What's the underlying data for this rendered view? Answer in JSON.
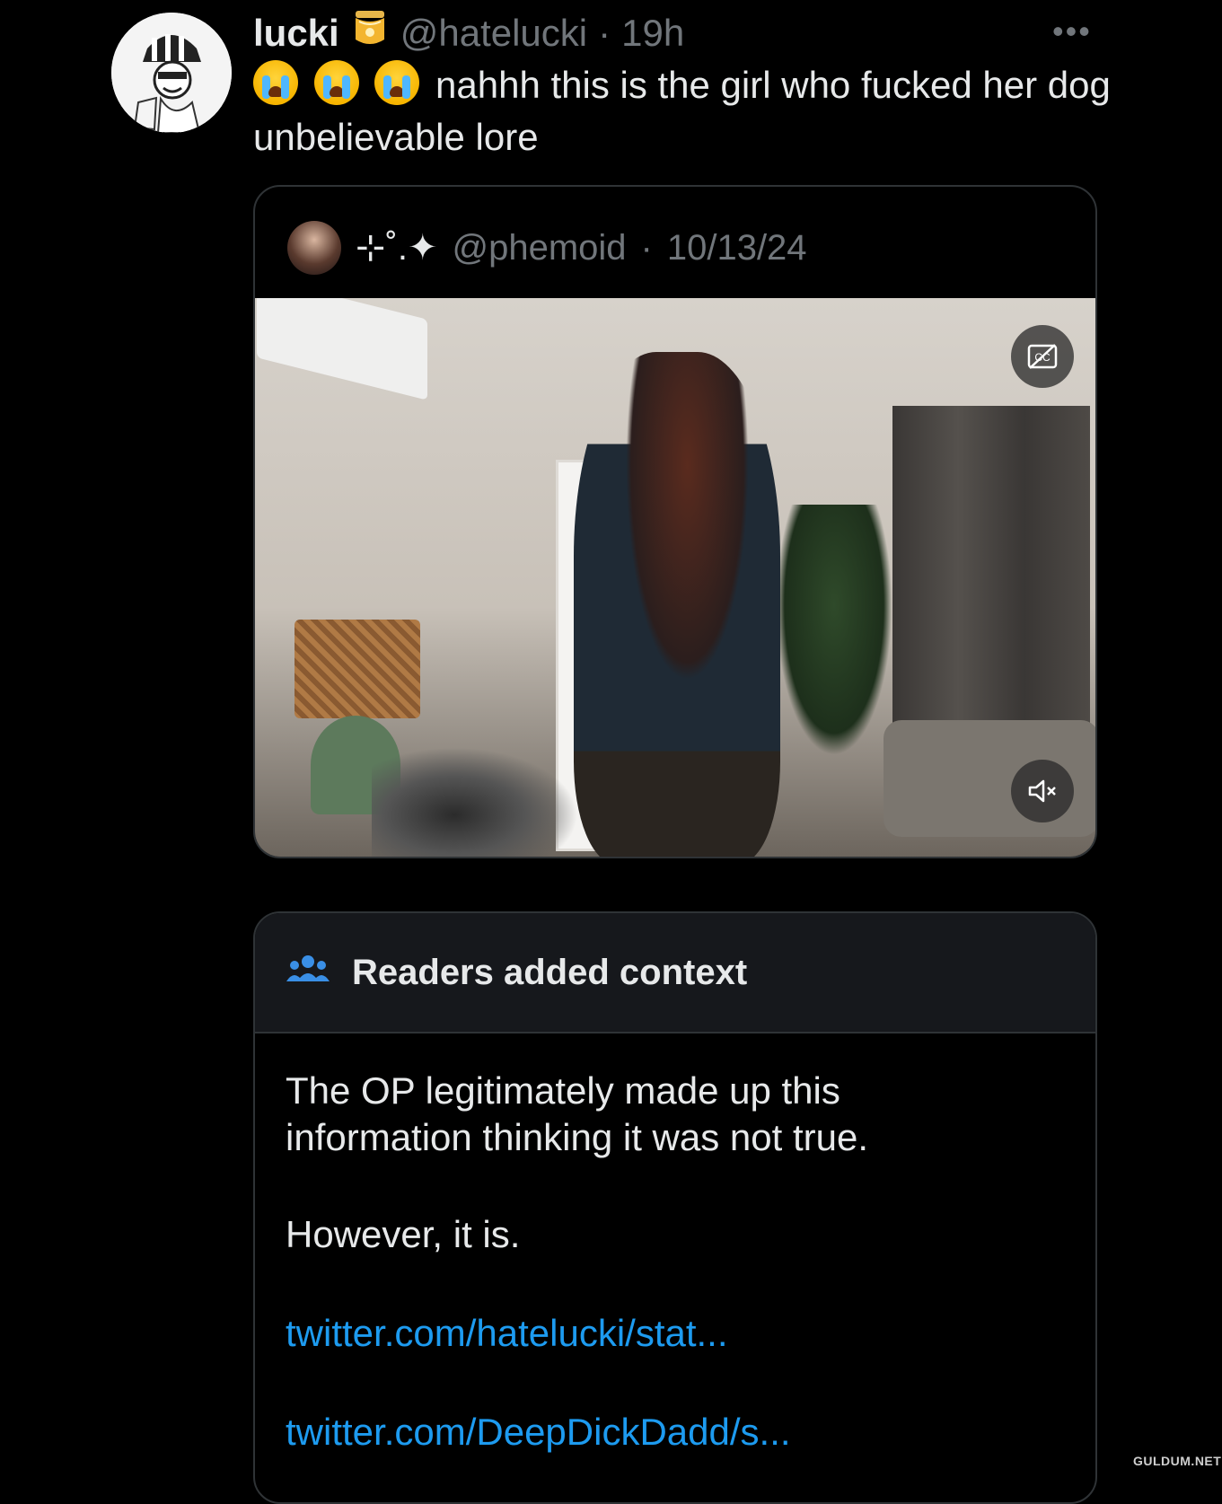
{
  "tweet": {
    "display_name": "lucki",
    "name_emoji": "honey-pot-icon",
    "handle": "@hatelucki",
    "separator": "·",
    "time": "19h",
    "more_label": "•••",
    "emojis": [
      "loudly-crying-face-icon",
      "loudly-crying-face-icon",
      "loudly-crying-face-icon"
    ],
    "text": "nahhh this is the girl who fucked her dog unbelievable lore"
  },
  "quoted": {
    "display_name": "⊹˚.✦",
    "handle": "@phemoid",
    "separator": "·",
    "date": "10/13/24",
    "video": {
      "cc_icon": "captions-off-icon",
      "mute_icon": "speaker-muted-icon"
    }
  },
  "context": {
    "icon": "people-group-icon",
    "title": "Readers added context",
    "body": "The OP legitimately made up this information thinking it was not true.",
    "body2": "However, it is.",
    "links": [
      "twitter.com/hatelucki/stat...",
      "twitter.com/DeepDickDadd/s..."
    ]
  },
  "watermark": "GULDUM.NET",
  "colors": {
    "background": "#000000",
    "text": "#e7e9ea",
    "muted": "#71767b",
    "link": "#1d9bf0",
    "context_icon": "#3a8fe6",
    "context_header_bg": "#16181c"
  }
}
